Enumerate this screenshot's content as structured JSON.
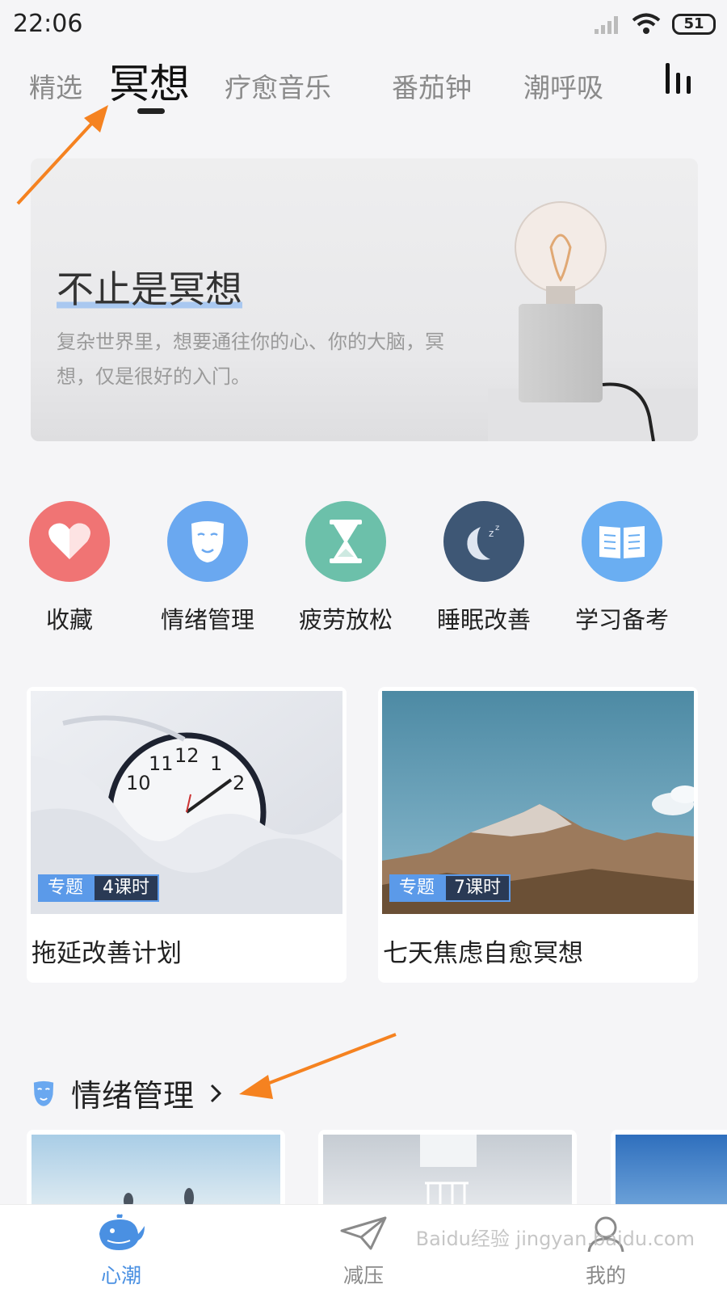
{
  "status_bar": {
    "time": "22:06",
    "battery": "51"
  },
  "top_tabs": [
    {
      "label": "精选"
    },
    {
      "label": "冥想"
    },
    {
      "label": "疗愈音乐"
    },
    {
      "label": "番茄钟"
    },
    {
      "label": "潮呼吸"
    }
  ],
  "active_tab": "冥想",
  "banner": {
    "title": "不止是冥想",
    "description": "复杂世界里，想要通往你的心、你的大脑，冥想，仅是很好的入门。"
  },
  "categories": [
    {
      "label": "收藏",
      "icon": "heart-icon",
      "color": "#f07474"
    },
    {
      "label": "情绪管理",
      "icon": "mask-icon",
      "color": "#6aa8f0"
    },
    {
      "label": "疲劳放松",
      "icon": "hourglass-icon",
      "color": "#6cc0aa"
    },
    {
      "label": "睡眠改善",
      "icon": "moon-icon",
      "color": "#3e5775"
    },
    {
      "label": "学习备考",
      "icon": "book-icon",
      "color": "#6aaef2"
    }
  ],
  "courses": [
    {
      "type": "专题",
      "lessons": "4课时",
      "title": "拖延改善计划"
    },
    {
      "type": "专题",
      "lessons": "7课时",
      "title": "七天焦虑自愈冥想"
    }
  ],
  "section": {
    "title": "情绪管理"
  },
  "bottom_nav": [
    {
      "label": "心潮",
      "icon": "whale-icon",
      "active": true
    },
    {
      "label": "减压",
      "icon": "paper-plane-icon",
      "active": false
    },
    {
      "label": "我的",
      "icon": "profile-icon",
      "active": false
    }
  ],
  "watermark": "Baidu经验 jingyan.baidu.com",
  "colors": {
    "accent": "#4a90e2",
    "arrow": "#f58220"
  }
}
